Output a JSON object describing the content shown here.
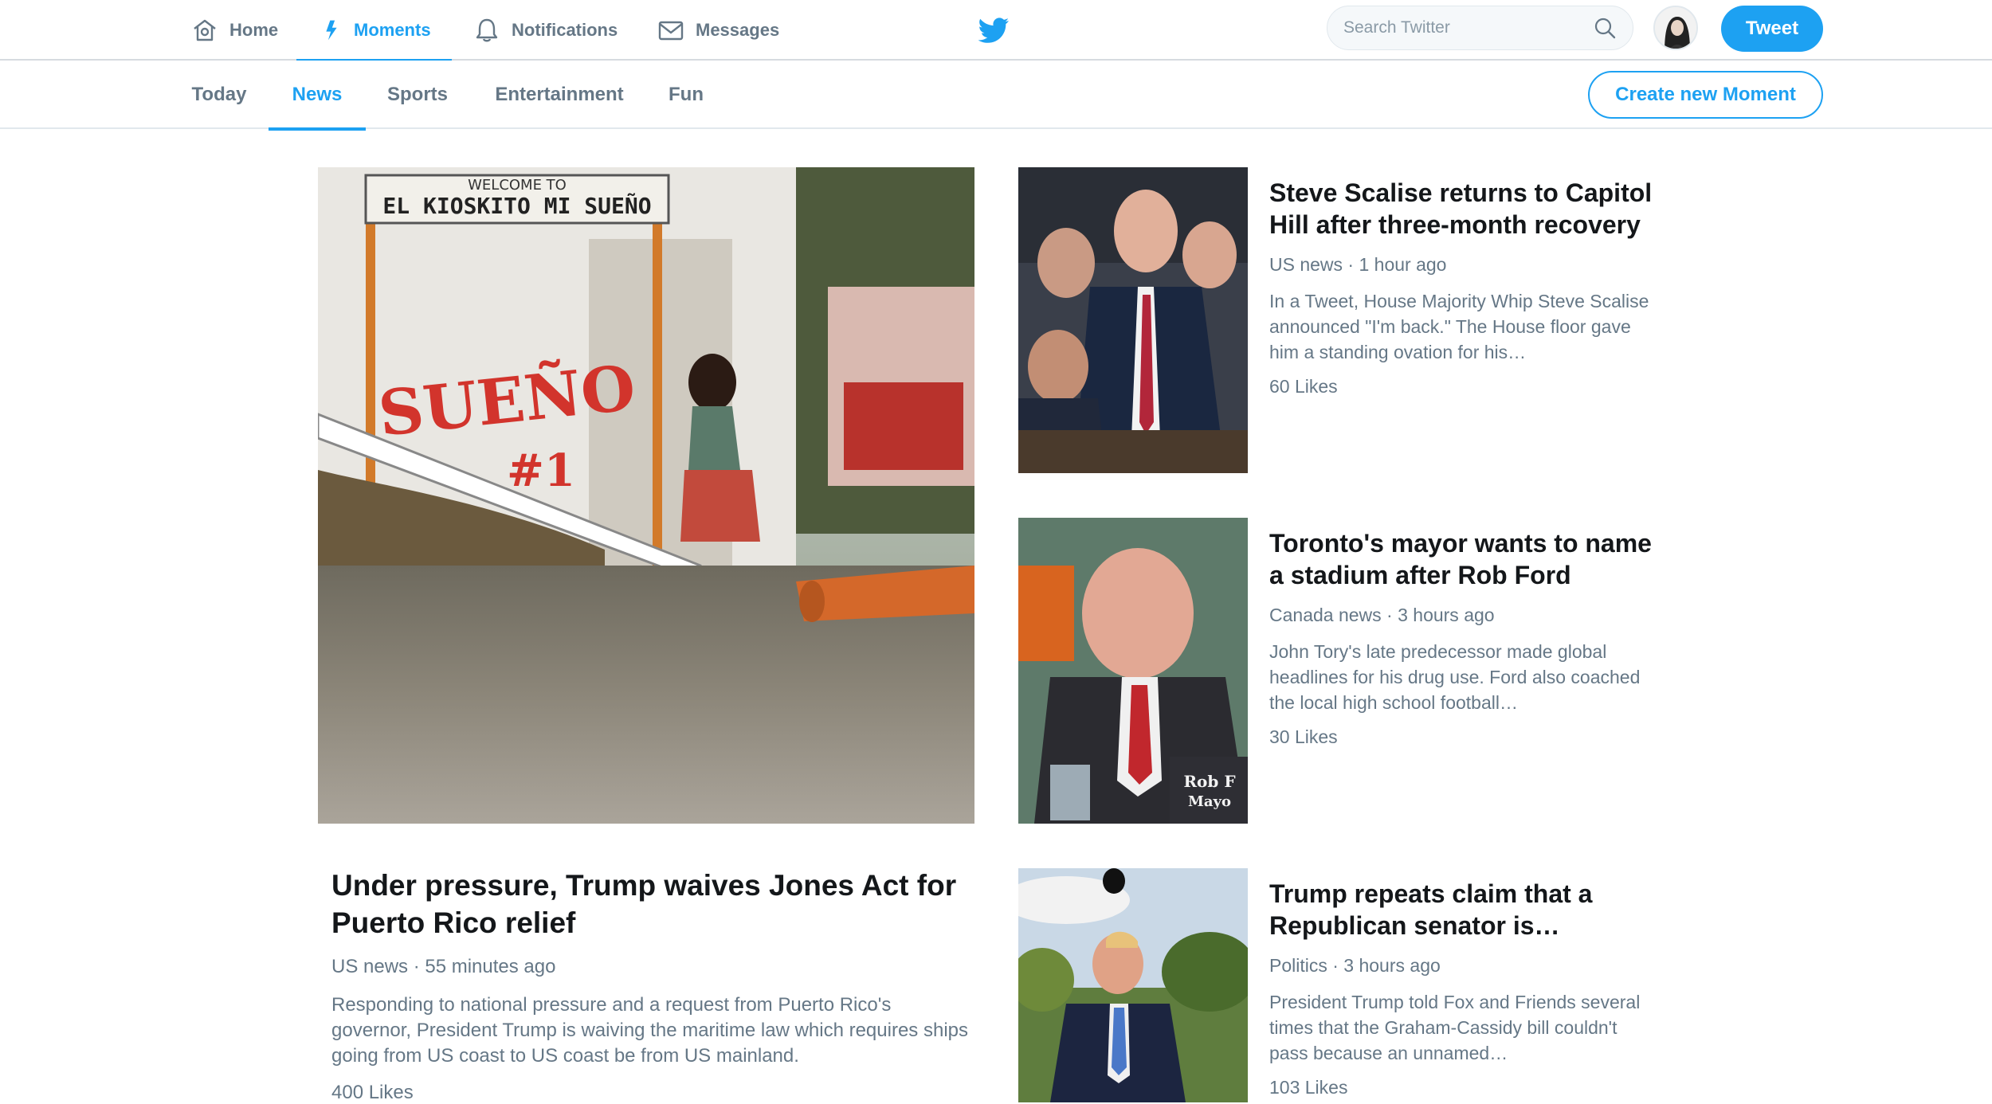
{
  "nav": {
    "home": "Home",
    "moments": "Moments",
    "notifications": "Notifications",
    "messages": "Messages",
    "search_placeholder": "Search Twitter",
    "tweet": "Tweet",
    "active": "Moments"
  },
  "subnav": {
    "tabs": [
      "Today",
      "News",
      "Sports",
      "Entertainment",
      "Fun"
    ],
    "active_tab": "News",
    "create": "Create new Moment"
  },
  "icons": {
    "home": "home-icon",
    "moments": "lightning-icon",
    "notifications": "bell-icon",
    "messages": "envelope-icon",
    "logo": "twitter-bird-icon",
    "search": "magnifier-icon"
  },
  "colors": {
    "accent": "#1da1f2",
    "text": "#14171a",
    "muted": "#657786"
  },
  "hero": {
    "sign_top": "WELCOME TO",
    "sign_main": "EL KIOSKITO MI SUEÑO",
    "wall_text": "SUEÑO",
    "wall_number": "#1",
    "title": "Under pressure, Trump waives Jones Act for Puerto Rico relief",
    "meta": "US news · 55 minutes ago",
    "desc": "Responding to national pressure and a request from Puerto Rico's governor, President Trump is waiving the maritime law which requires ships going from US coast to US coast be from US mainland.",
    "likes": "400 Likes"
  },
  "cards": [
    {
      "title": "Steve Scalise returns to Capitol Hill after three-month recovery",
      "meta": "US news · 1 hour ago",
      "desc": "In a Tweet, House Majority Whip Steve Scalise announced \"I'm back.\" The House floor gave him a standing ovation for his…",
      "likes": "60 Likes"
    },
    {
      "title": "Toronto's mayor wants to name a stadium after Rob Ford",
      "meta": "Canada news · 3 hours ago",
      "desc": "John Tory's late predecessor made global headlines for his drug use. Ford also coached the local high school football…",
      "likes": "30 Likes",
      "placard_line1": "Rob F",
      "placard_line2": "Mayo"
    },
    {
      "title": "Trump repeats claim that a Republican senator is…",
      "meta": "Politics · 3 hours ago",
      "desc": "President Trump told Fox and Friends several times that the Graham-Cassidy bill couldn't pass because an unnamed…",
      "likes": "103 Likes"
    }
  ]
}
